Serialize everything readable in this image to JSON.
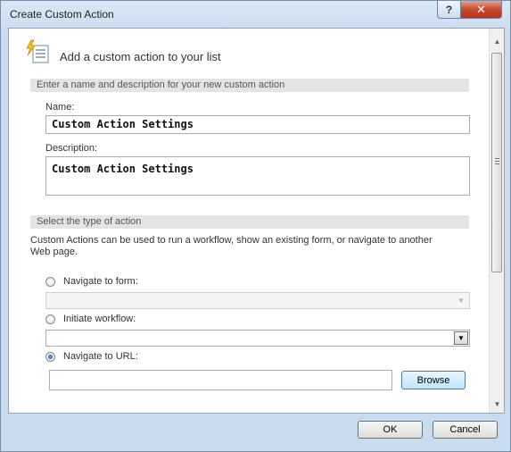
{
  "window": {
    "title": "Create Custom Action",
    "help_label": "?",
    "close_label": "✕"
  },
  "header": {
    "icon": "custom-action-icon",
    "text": "Add a custom action to your list"
  },
  "section_name": {
    "title": "Enter a name and description for your new custom action",
    "name_label": "Name:",
    "name_value": "Custom Action Settings",
    "description_label": "Description:",
    "description_value": "Custom Action Settings"
  },
  "section_action": {
    "title": "Select the type of action",
    "description_line1": "Custom Actions can be used to run a workflow, show an existing form, or navigate to another",
    "description_line2": "Web page.",
    "options": [
      {
        "label": "Navigate to form:",
        "selected": false
      },
      {
        "label": "Initiate workflow:",
        "selected": false
      },
      {
        "label": "Navigate to URL:",
        "selected": true
      }
    ],
    "url_value": "",
    "browse_label": "Browse"
  },
  "footer": {
    "ok_label": "OK",
    "cancel_label": "Cancel"
  },
  "icons": {
    "dropdown_arrow": "▼",
    "scroll_up": "▲",
    "scroll_down": "▼"
  }
}
